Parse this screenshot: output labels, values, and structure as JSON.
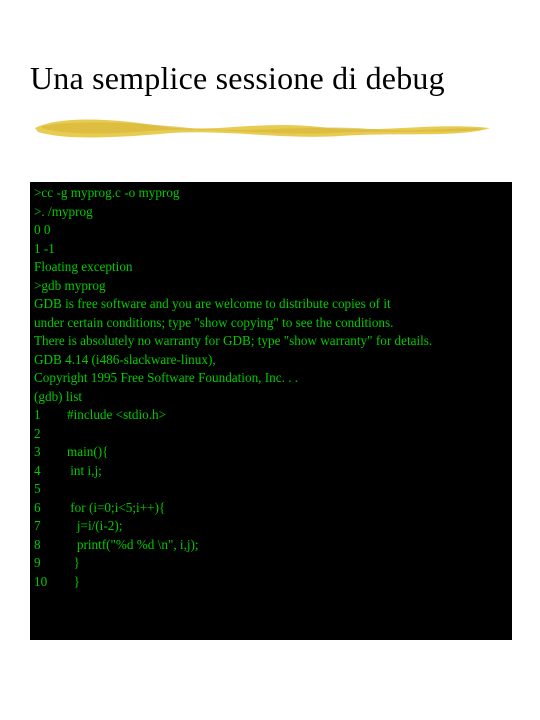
{
  "title": "Una semplice sessione di debug",
  "terminal": {
    "lines": [
      ">cc -g myprog.c -o myprog",
      ">. /myprog",
      "0 0",
      "1 -1",
      "Floating exception",
      ">gdb myprog",
      "GDB is free software and you are welcome to distribute copies of it",
      "under certain conditions; type \"show copying\" to see the conditions.",
      "There is absolutely no warranty for GDB; type \"show warranty\" for details.",
      "GDB 4.14 (i486-slackware-linux),",
      "Copyright 1995 Free Software Foundation, Inc. . .",
      "(gdb) list",
      "1        #include <stdio.h>",
      "2",
      "3        main(){",
      "4         int i,j;",
      "5",
      "6         for (i=0;i<5;i++){",
      "7           j=i/(i-2);",
      "8           printf(\"%d %d \\n\", i,j);",
      "9          }",
      "10        }"
    ]
  }
}
